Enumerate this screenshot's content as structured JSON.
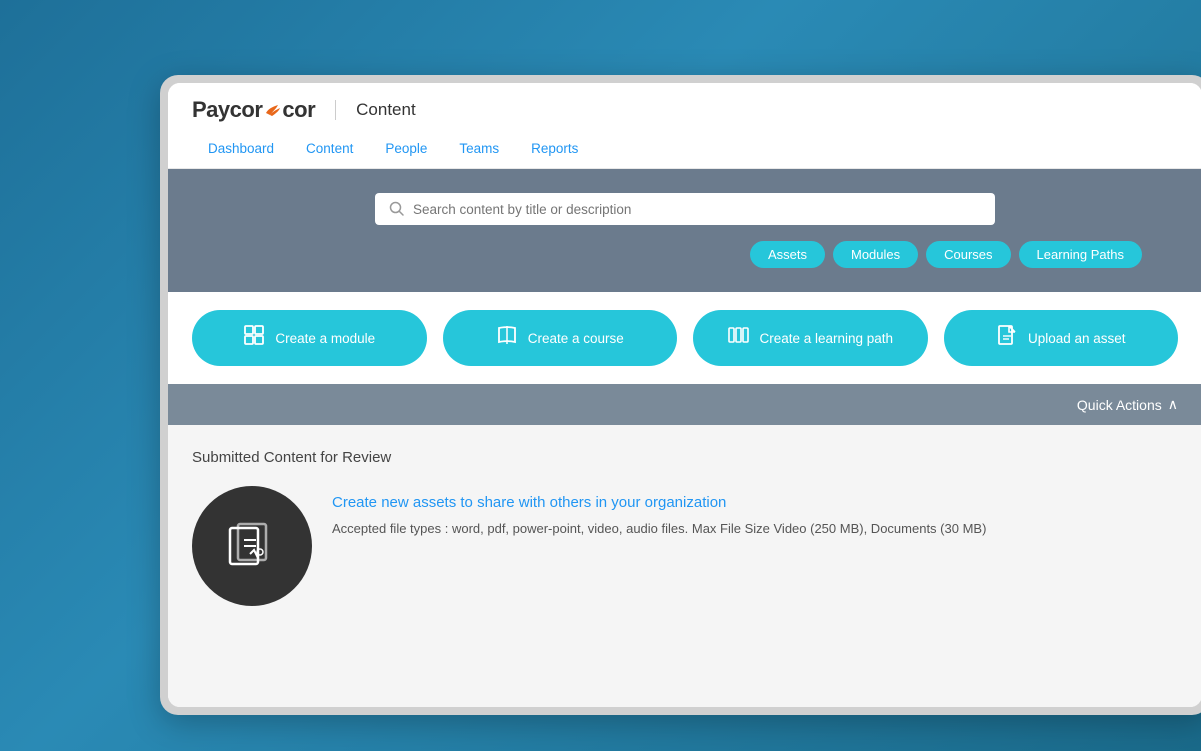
{
  "app": {
    "logo_text": "Paycor",
    "app_title": "Content"
  },
  "nav": {
    "items": [
      {
        "label": "Dashboard",
        "id": "dashboard"
      },
      {
        "label": "Content",
        "id": "content"
      },
      {
        "label": "People",
        "id": "people"
      },
      {
        "label": "Teams",
        "id": "teams"
      },
      {
        "label": "Reports",
        "id": "reports"
      }
    ]
  },
  "search": {
    "placeholder": "Search content by title or description"
  },
  "chips": [
    {
      "label": "Assets",
      "id": "assets"
    },
    {
      "label": "Modules",
      "id": "modules"
    },
    {
      "label": "Courses",
      "id": "courses"
    },
    {
      "label": "Learning Paths",
      "id": "learning-paths"
    }
  ],
  "action_buttons": [
    {
      "label": "Create a module",
      "id": "create-module",
      "icon": "⊞"
    },
    {
      "label": "Create a course",
      "id": "create-course",
      "icon": "📖"
    },
    {
      "label": "Create a learning path",
      "id": "create-learning-path",
      "icon": "📚"
    },
    {
      "label": "Upload an asset",
      "id": "upload-asset",
      "icon": "📄"
    }
  ],
  "quick_actions": {
    "label": "Quick Actions",
    "icon": "∧"
  },
  "content_section": {
    "title": "Submitted Content for Review",
    "empty_state": {
      "title": "Create new assets to share with others in your organization",
      "description": "Accepted file types : word, pdf, power-point, video, audio files. Max File Size Video (250 MB), Documents (30 MB)"
    }
  }
}
